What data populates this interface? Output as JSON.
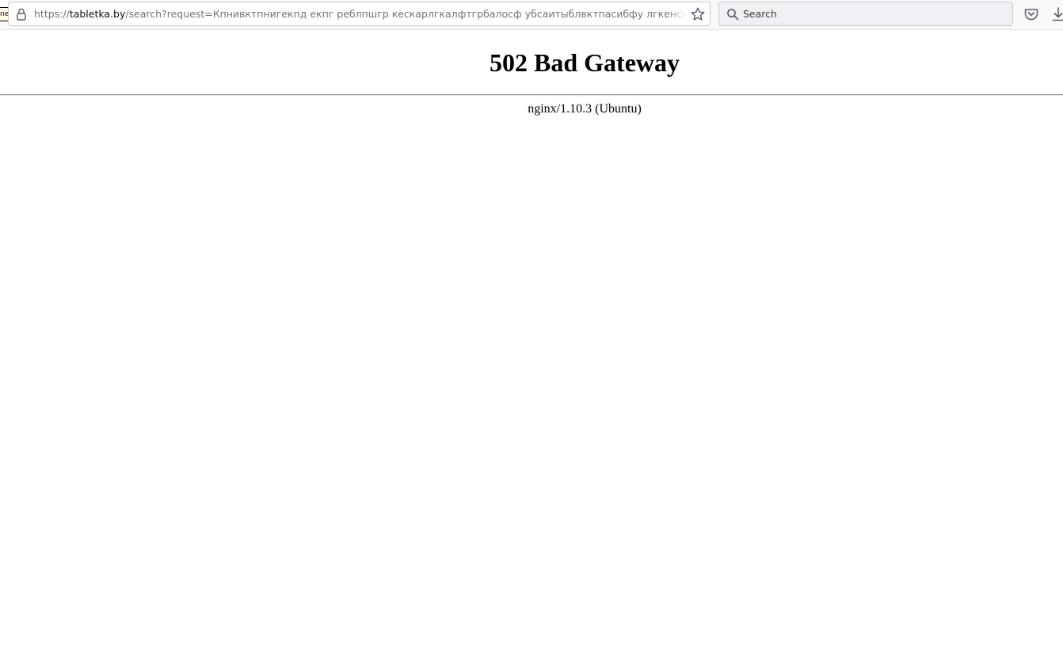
{
  "browser": {
    "page_tag": "ne",
    "url": {
      "scheme": "https://",
      "host": "tabletka.by",
      "path": "/search?request=Кпнивктпнигекпд екпг реблпшгр кескарлгкалфтгрбалосф убсаитыблвктпасибфу лгкенсиблугк вапидыблг"
    },
    "search": {
      "placeholder": "Search",
      "value": ""
    },
    "icons": [
      "lock-icon",
      "star-icon",
      "search-icon",
      "pocket-icon",
      "download-icon"
    ]
  },
  "page": {
    "title": "502 Bad Gateway",
    "server": "nginx/1.10.3 (Ubuntu)"
  }
}
